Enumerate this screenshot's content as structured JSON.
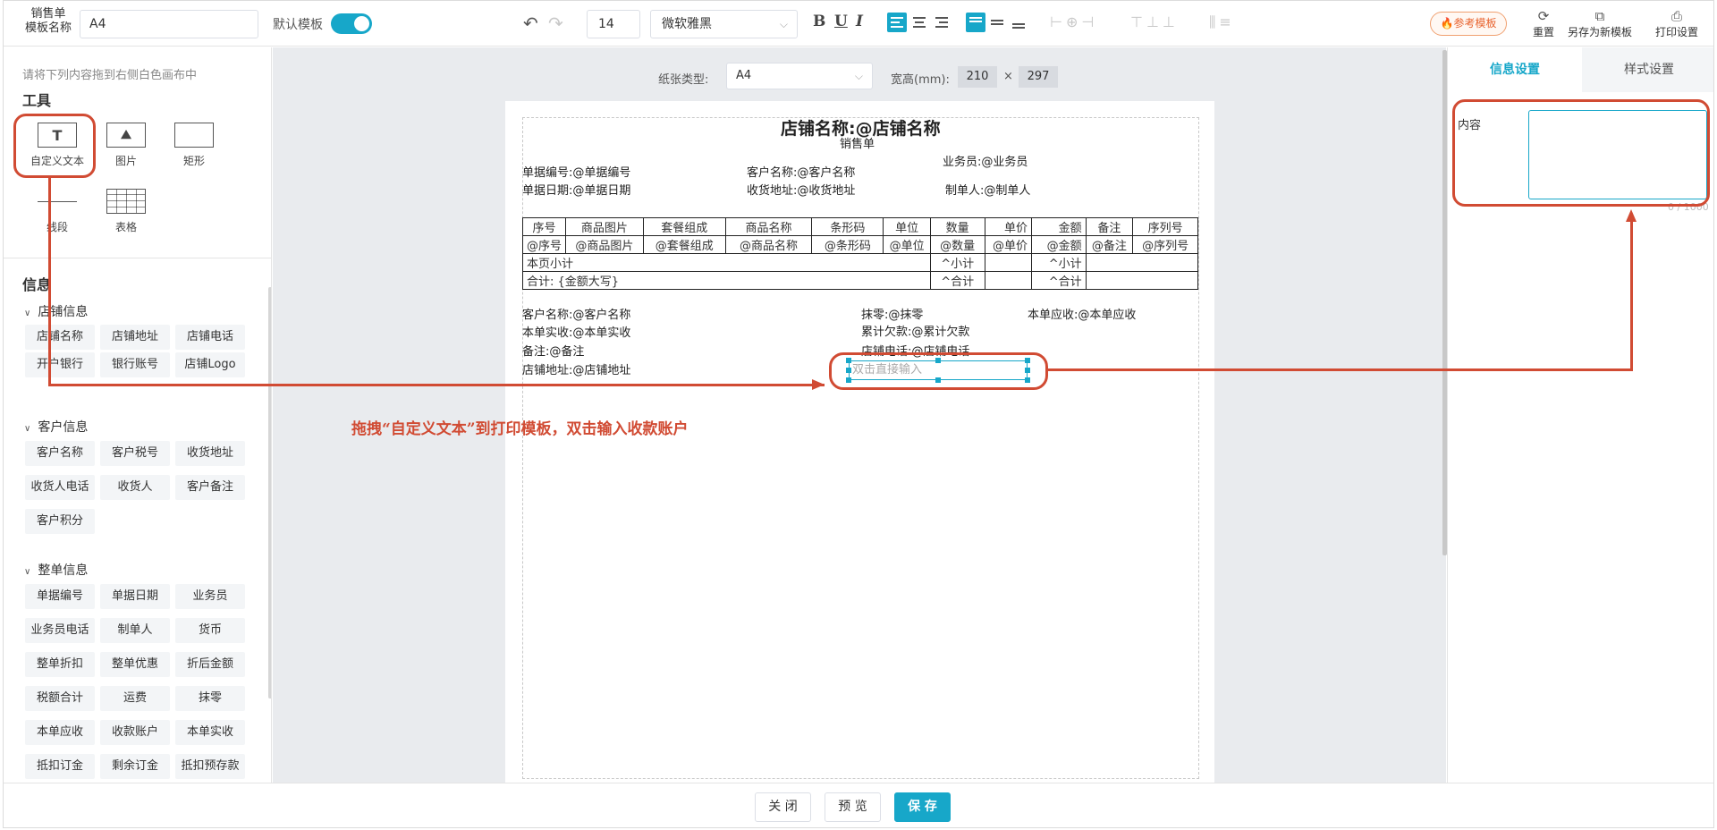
{
  "toolbar": {
    "template_name_label": "销售单\n模板名称",
    "template_name_value": "A4",
    "default_template_label": "默认模板",
    "font_size": "14",
    "font_family": "微软雅黑",
    "bold": "B",
    "underline": "U",
    "italic": "I",
    "ref_template": "🔥参考模板",
    "reset": "重置",
    "save_as_new": "另存为新模板",
    "print_settings": "打印设置"
  },
  "left": {
    "hint": "请将下列内容拖到右侧白色画布中",
    "tools_title": "工具",
    "tools": [
      "自定义文本",
      "图片",
      "矩形",
      "线段",
      "表格"
    ],
    "info_title": "信息",
    "groups": [
      {
        "name": "店铺信息",
        "items": [
          "店铺名称",
          "店铺地址",
          "店铺电话",
          "开户银行",
          "银行账号",
          "店铺Logo"
        ]
      },
      {
        "name": "客户信息",
        "items": [
          "客户名称",
          "客户税号",
          "收货地址",
          "收货人电话",
          "收货人",
          "客户备注",
          "客户积分"
        ]
      },
      {
        "name": "整单信息",
        "items": [
          "单据编号",
          "单据日期",
          "业务员",
          "业务员电话",
          "制单人",
          "货币",
          "整单折扣",
          "整单优惠",
          "折后金额",
          "税额合计",
          "运费",
          "抹零",
          "本单应收",
          "收款账户",
          "本单实收",
          "抵扣订金",
          "剩余订金",
          "抵扣预存款"
        ]
      }
    ]
  },
  "canvas": {
    "paper_type_label": "纸张类型:",
    "paper_type": "A4",
    "wh_label": "宽高(mm):",
    "width": "210",
    "times": "×",
    "height": "297",
    "store_title": "店铺名称:@店铺名称",
    "doc_title": "销售单",
    "fields": {
      "doc_no": "单据编号:@单据编号",
      "customer": "客户名称:@客户名称",
      "salesman": "业务员:@业务员",
      "doc_date": "单据日期:@单据日期",
      "address": "收货地址:@收货地址",
      "maker": "制单人:@制单人",
      "f_customer": "客户名称:@客户名称",
      "f_discount": "抹零:@抹零",
      "f_receivable": "本单应收:@本单应收",
      "f_received": "本单实收:@本单实收",
      "f_debt": "累计欠款:@累计欠款",
      "f_note": "备注:@备注",
      "f_phone": "店铺电话:@店铺电话",
      "f_store_addr": "店铺地址:@店铺地址"
    },
    "table_headers": [
      "序号",
      "商品图片",
      "套餐组成",
      "商品名称",
      "条形码",
      "单位",
      "数量",
      "单价",
      "金额",
      "备注",
      "序列号"
    ],
    "table_row": [
      "@序号",
      "@商品图片",
      "@套餐组成",
      "@商品名称",
      "@条形码",
      "@单位",
      "@数量",
      "@单价",
      "@金额",
      "@备注",
      "@序列号"
    ],
    "subtotal_label": "本页小计",
    "subtotal_qty": "^小计",
    "subtotal_amt": "^小计",
    "total_label": "合计: {金额大写}",
    "total_qty": "^合计",
    "total_amt": "^合计",
    "selected_placeholder": "双击直接输入"
  },
  "right": {
    "tab_info": "信息设置",
    "tab_style": "样式设置",
    "content_label": "内容",
    "content_value": "",
    "counter": "0 / 1000"
  },
  "footer": {
    "close": "关 闭",
    "preview": "预 览",
    "save": "保 存"
  },
  "annotation": {
    "text": "拖拽“自定义文本”到打印模板，双击输入收款账户"
  },
  "colors": {
    "accent": "#17a7c9",
    "annotation": "#d14b33"
  }
}
